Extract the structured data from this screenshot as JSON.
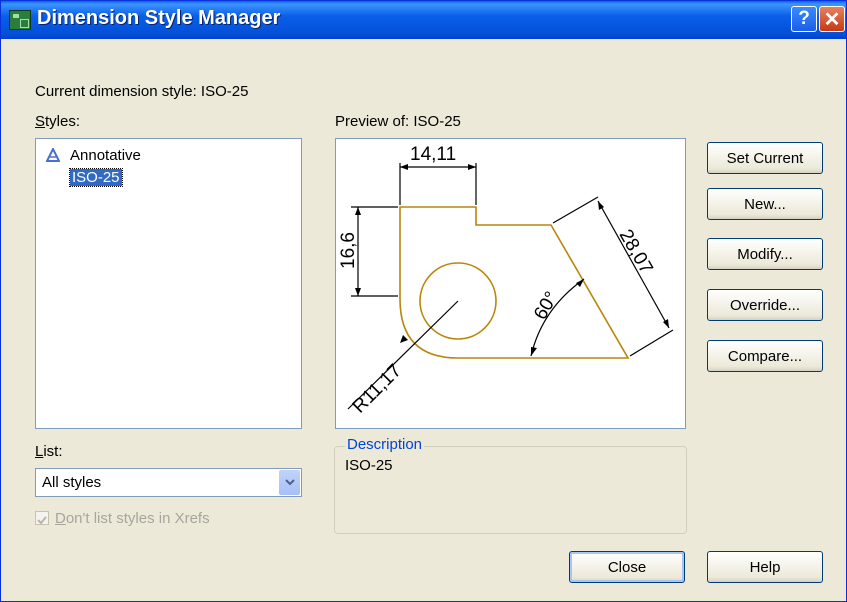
{
  "window": {
    "title": "Dimension Style Manager"
  },
  "titlebar": {
    "help": "?",
    "close": "✕"
  },
  "current_style": "Current dimension style: ISO-25",
  "styles": {
    "label": "Styles:",
    "items": [
      "Annotative",
      "ISO-25"
    ]
  },
  "preview": {
    "label": "Preview of: ISO-25",
    "dims": {
      "top": "14,11",
      "left": "16,6",
      "right": "28,07",
      "angle": "60°",
      "radius": "R11,17"
    }
  },
  "buttons": {
    "set_current": "Set Current",
    "new": "New...",
    "modify": "Modify...",
    "override": "Override...",
    "compare": "Compare...",
    "close": "Close",
    "help": "Help"
  },
  "list": {
    "label": "List:",
    "value": "All styles"
  },
  "xrefs": {
    "label": "Don't list styles in Xrefs",
    "checked": true
  },
  "description": {
    "legend": "Description",
    "text": "ISO-25"
  },
  "colors": {
    "geometry": "#b8860b",
    "selection": "#316ac5",
    "titlebar": "#0a5ee8"
  }
}
